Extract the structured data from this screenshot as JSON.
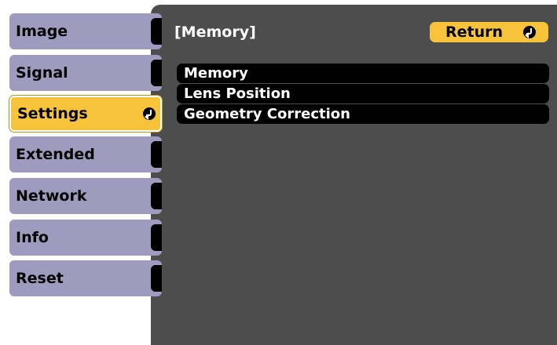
{
  "sidebar": {
    "items": [
      {
        "label": "Image",
        "active": false
      },
      {
        "label": "Signal",
        "active": false
      },
      {
        "label": "Settings",
        "active": true
      },
      {
        "label": "Extended",
        "active": false
      },
      {
        "label": "Network",
        "active": false
      },
      {
        "label": "Info",
        "active": false
      },
      {
        "label": "Reset",
        "active": false
      }
    ],
    "active_icon": "enter-icon"
  },
  "header": {
    "breadcrumb": "[Memory]",
    "return_label": "Return",
    "return_icon": "enter-icon"
  },
  "menu": {
    "items": [
      {
        "label": "Memory"
      },
      {
        "label": "Lens Position"
      },
      {
        "label": "Geometry Correction"
      }
    ]
  },
  "colors": {
    "sidebar_item": "#9e9bbf",
    "accent": "#f7c33a",
    "panel": "#4d4d4d",
    "menu_row": "#000000",
    "text_light": "#ffffff"
  }
}
